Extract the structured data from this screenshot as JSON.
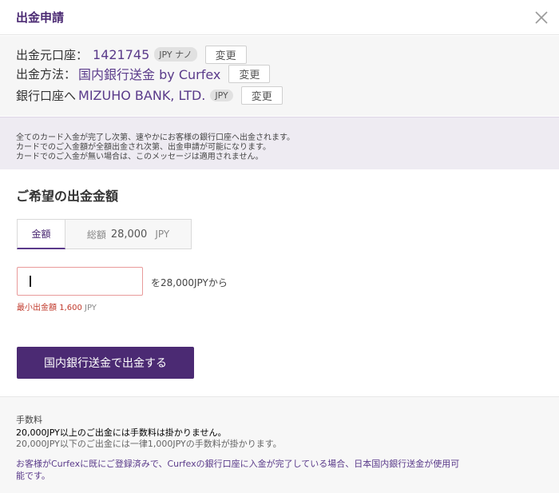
{
  "header": {
    "title": "出金申請"
  },
  "account": {
    "source_label": "出金元口座：",
    "source_number": "1421745",
    "source_badge": "JPY ナノ",
    "method_label": "出金方法：",
    "method_value": "国内銀行送金 by Curfex",
    "bank_label": "銀行口座へ",
    "bank_value": "MIZUHO BANK, LTD.",
    "bank_badge": "JPY",
    "change_label": "変更"
  },
  "notice": {
    "lines": [
      "全てのカード入金が完了し次第、速やかにお客様の銀行口座へ出金されます。",
      "カードでのご入金額が全額出金され次第、出金申請が可能になります。",
      "カードでのご入金が無い場合は、このメッセージは適用されません。"
    ]
  },
  "amount": {
    "section_title": "ご希望の出金金額",
    "tab_amount": "金額",
    "tab_total_label": "総額",
    "tab_total_value": "28,000",
    "tab_total_currency": "JPY",
    "input_value": "",
    "from_text": "を28,000JPYから",
    "min_label": "最小出金額",
    "min_value": "1,600",
    "min_currency": "JPY"
  },
  "submit": {
    "label": "国内銀行送金で出金する"
  },
  "fee": {
    "title": "手数料",
    "line1": "20,000JPY以上のご出金には手数料は掛かりません。",
    "line2": "20,000JPY以下のご出金には一律1,000JPYの手数料が掛かります。",
    "line3": "お客様がCurfexに既にご登録済みで、Curfexの銀行口座に入金が完了している場合、日本国内銀行送金が使用可",
    "line4": "能です。"
  },
  "colors": {
    "brand": "#4b2a73",
    "accent_text": "#5a3a8a",
    "notice_bg": "#eeebf2",
    "error": "#c0392b"
  },
  "icons": {
    "close": "close-icon"
  }
}
